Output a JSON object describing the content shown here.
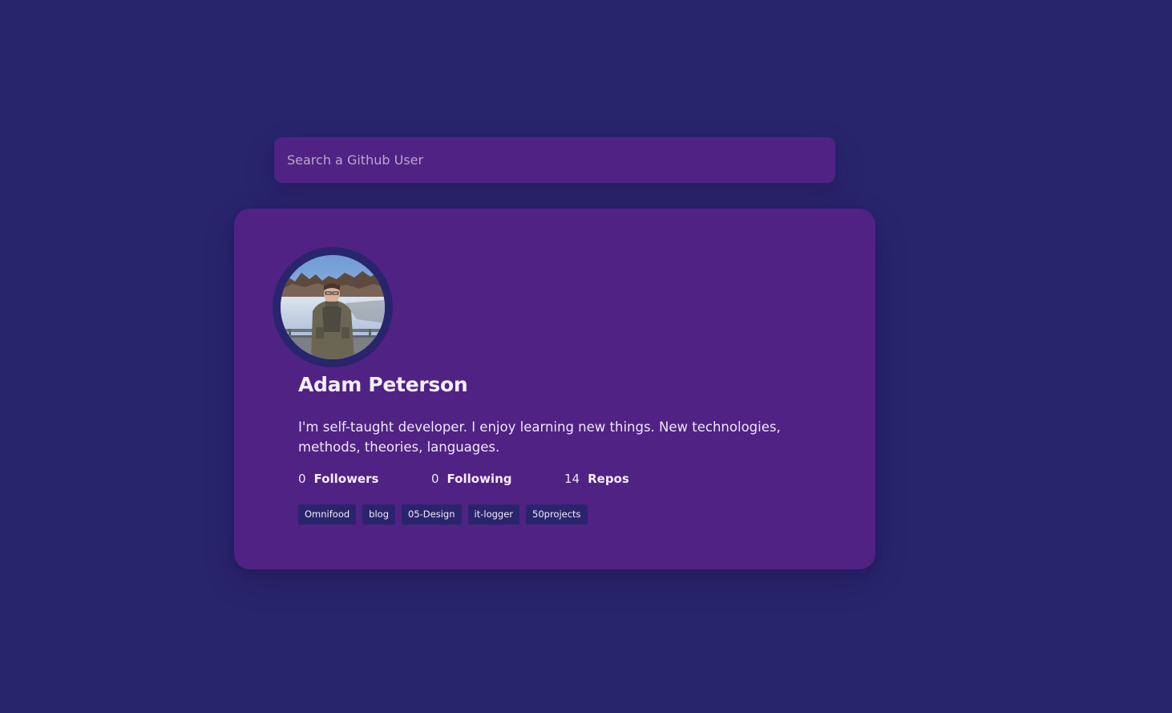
{
  "search": {
    "placeholder": "Search a Github User",
    "value": ""
  },
  "user": {
    "name": "Adam Peterson",
    "bio": "I'm self-taught developer. I enjoy learning new things. New technologies, methods, theories, languages.",
    "stats": {
      "followers": {
        "count": "0",
        "label": "Followers"
      },
      "following": {
        "count": "0",
        "label": "Following"
      },
      "repos": {
        "count": "14",
        "label": "Repos"
      }
    },
    "repos": [
      "Omnifood",
      "blog",
      "05-Design",
      "it-logger",
      "50projects"
    ]
  },
  "colors": {
    "background": "#29256d",
    "card": "#4f2283",
    "repo_tag": "#29256d",
    "text": "#f1ecf8"
  }
}
